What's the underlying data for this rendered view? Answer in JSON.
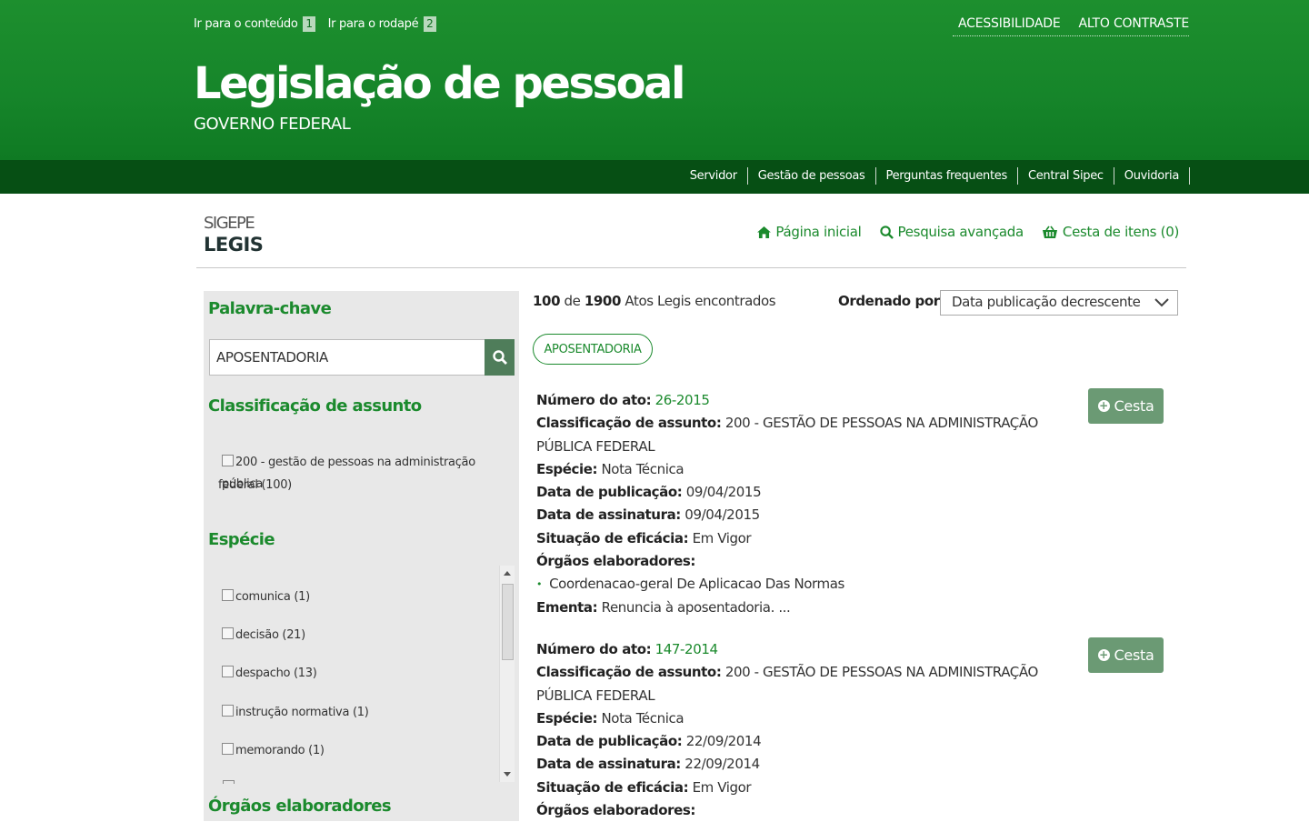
{
  "skip_links": [
    {
      "label": "Ir para o conteúdo",
      "key": "1"
    },
    {
      "label": "Ir para o rodapé",
      "key": "2"
    }
  ],
  "accessibility": {
    "acc": "ACESSIBILIDADE",
    "contrast": "ALTO CONTRASTE"
  },
  "site_title": "Legislação de pessoal",
  "site_subtitle": "GOVERNO FEDERAL",
  "nav": [
    "Servidor",
    "Gestão de pessoas",
    "Perguntas frequentes",
    "Central Sipec",
    "Ouvidoria"
  ],
  "brand": {
    "line1": "SIGEPE",
    "line2": "LEGIS"
  },
  "top_links": {
    "home": "Página inicial",
    "advanced": "Pesquisa avançada",
    "basket": "Cesta de itens (0)"
  },
  "sidebar": {
    "keyword_title": "Palavra-chave",
    "keyword_value": "APOSENTADORIA",
    "class_title": "Classificação de assunto",
    "class_items": [
      "200 - gestão de pessoas na administração pública",
      "federal (100)"
    ],
    "especie_title": "Espécie",
    "especie_items": [
      "comunica (1)",
      "decisão (21)",
      "despacho (13)",
      "instrução normativa (1)",
      "memorando (1)"
    ],
    "orgaos_title": "Órgãos elaboradores"
  },
  "results": {
    "shown": "100",
    "total": "1900",
    "found_text": "Atos Legis encontrados",
    "de": "de",
    "sort_label": "Ordenado por:",
    "sort_value": "Data publicação decrescente",
    "tag": "APOSENTADORIA",
    "cesta_label": "Cesta",
    "labels": {
      "numero": "Número do ato:",
      "classificacao": "Classificação de assunto:",
      "especie": "Espécie:",
      "publicacao": "Data de publicação:",
      "assinatura": "Data de assinatura:",
      "situacao": "Situação de eficácia:",
      "orgaos": "Órgãos elaboradores:",
      "ementa": "Ementa:"
    },
    "items": [
      {
        "numero": "26-2015",
        "classificacao_1": "200 - GESTÃO DE PESSOAS NA ADMINISTRAÇÃO",
        "classificacao_2": "PÚBLICA FEDERAL",
        "especie": "Nota Técnica",
        "publicacao": "09/04/2015",
        "assinatura": "09/04/2015",
        "situacao": "Em Vigor",
        "orgao": "Coordenacao-geral De Aplicacao Das Normas",
        "ementa": "Renuncia à aposentadoria. ..."
      },
      {
        "numero": "147-2014",
        "classificacao_1": "200 - GESTÃO DE PESSOAS NA ADMINISTRAÇÃO",
        "classificacao_2": "PÚBLICA FEDERAL",
        "especie": "Nota Técnica",
        "publicacao": "22/09/2014",
        "assinatura": "22/09/2014",
        "situacao": "Em Vigor"
      }
    ]
  },
  "colors": {
    "header_green": "#1d8f2e",
    "nav_dark": "#064f14",
    "link_green": "#1b8a2d",
    "button_green": "#6b9a74"
  },
  "icons": [
    "home-icon",
    "search-icon",
    "basket-icon",
    "plus-circle-icon",
    "chevron-down-icon"
  ]
}
